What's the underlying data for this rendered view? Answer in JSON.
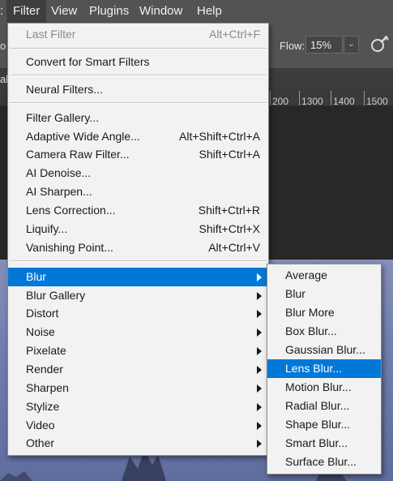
{
  "menubar": {
    "edge_char": ":",
    "items": [
      {
        "label": "Filter",
        "active": true
      },
      {
        "label": "View"
      },
      {
        "label": "Plugins"
      },
      {
        "label": "Window"
      },
      {
        "label": "Help"
      }
    ]
  },
  "options_bar": {
    "edge_char": "o",
    "flow_label": "Flow:",
    "flow_value": "15%"
  },
  "tab_strip": {
    "edge_char": "al"
  },
  "ruler": {
    "ticks": [
      "200",
      "1300",
      "1400",
      "1500"
    ]
  },
  "filter_menu": {
    "groups": [
      [
        {
          "label": "Last Filter",
          "shortcut": "Alt+Ctrl+F",
          "disabled": true
        }
      ],
      [
        {
          "label": "Convert for Smart Filters"
        }
      ],
      [
        {
          "label": "Neural Filters..."
        }
      ],
      [
        {
          "label": "Filter Gallery..."
        },
        {
          "label": "Adaptive Wide Angle...",
          "shortcut": "Alt+Shift+Ctrl+A"
        },
        {
          "label": "Camera Raw Filter...",
          "shortcut": "Shift+Ctrl+A"
        },
        {
          "label": "AI Denoise..."
        },
        {
          "label": "AI Sharpen..."
        },
        {
          "label": "Lens Correction...",
          "shortcut": "Shift+Ctrl+R"
        },
        {
          "label": "Liquify...",
          "shortcut": "Shift+Ctrl+X"
        },
        {
          "label": "Vanishing Point...",
          "shortcut": "Alt+Ctrl+V"
        }
      ],
      [
        {
          "label": "Blur",
          "submenu": true,
          "highlighted": true
        },
        {
          "label": "Blur Gallery",
          "submenu": true
        },
        {
          "label": "Distort",
          "submenu": true
        },
        {
          "label": "Noise",
          "submenu": true
        },
        {
          "label": "Pixelate",
          "submenu": true
        },
        {
          "label": "Render",
          "submenu": true
        },
        {
          "label": "Sharpen",
          "submenu": true
        },
        {
          "label": "Stylize",
          "submenu": true
        },
        {
          "label": "Video",
          "submenu": true
        },
        {
          "label": "Other",
          "submenu": true
        }
      ]
    ]
  },
  "blur_submenu": {
    "items": [
      {
        "label": "Average"
      },
      {
        "label": "Blur"
      },
      {
        "label": "Blur More"
      },
      {
        "label": "Box Blur..."
      },
      {
        "label": "Gaussian Blur..."
      },
      {
        "label": "Lens Blur...",
        "highlighted": true
      },
      {
        "label": "Motion Blur..."
      },
      {
        "label": "Radial Blur..."
      },
      {
        "label": "Shape Blur..."
      },
      {
        "label": "Smart Blur..."
      },
      {
        "label": "Surface Blur..."
      }
    ]
  },
  "colors": {
    "highlight": "#0078d7",
    "menu_bg": "#f2f2f2",
    "app_bg": "#535353"
  }
}
